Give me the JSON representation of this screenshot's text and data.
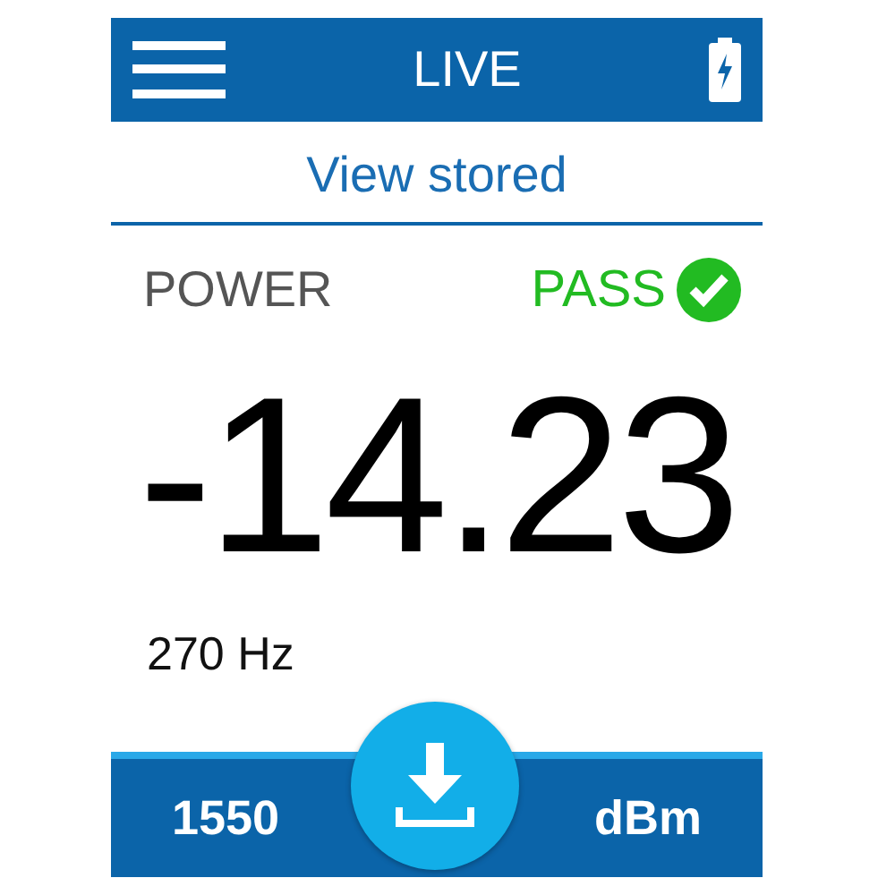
{
  "header": {
    "title": "LIVE"
  },
  "link": {
    "label": "View stored"
  },
  "measurement": {
    "label": "POWER",
    "status": {
      "label": "PASS",
      "kind": "pass"
    },
    "value": "-14.23",
    "frequency": "270 Hz"
  },
  "footer": {
    "wavelength": "1550",
    "unit": "dBm"
  }
}
